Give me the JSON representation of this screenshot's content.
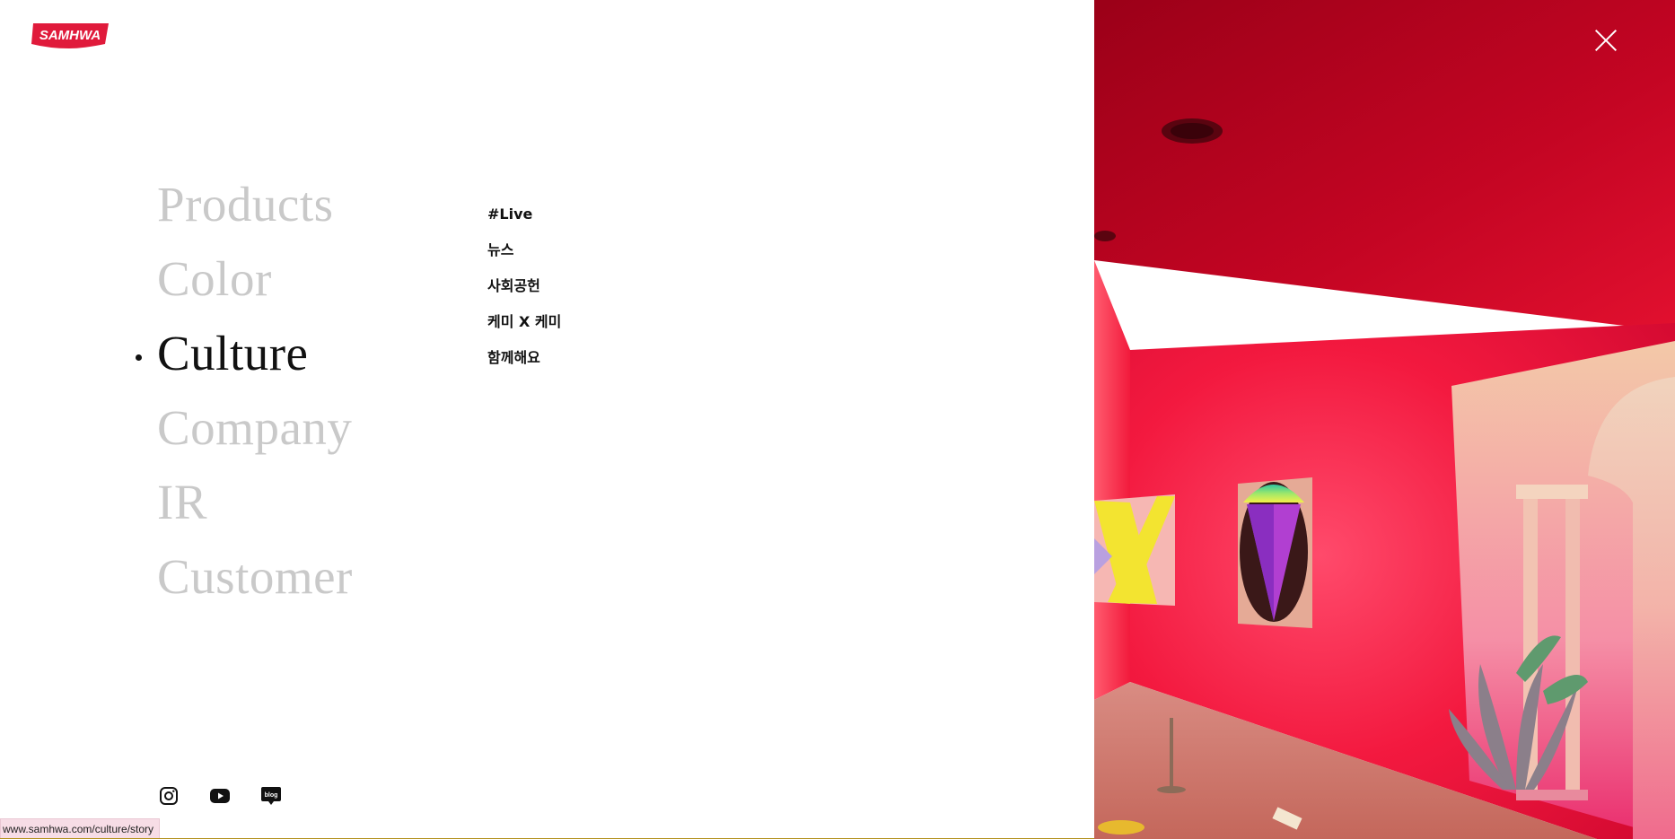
{
  "brand": {
    "logo_text": "SAMHWA",
    "color": "#e01a3b"
  },
  "main_menu": {
    "items": [
      {
        "label": "Products",
        "active": false
      },
      {
        "label": "Color",
        "active": false
      },
      {
        "label": "Culture",
        "active": true
      },
      {
        "label": "Company",
        "active": false
      },
      {
        "label": "IR",
        "active": false
      },
      {
        "label": "Customer",
        "active": false
      }
    ]
  },
  "sub_menu": {
    "items": [
      {
        "label": "#Live"
      },
      {
        "label": "뉴스"
      },
      {
        "label": "사회공헌"
      },
      {
        "label": "케미 X 케미"
      },
      {
        "label": "함께해요"
      }
    ]
  },
  "social": {
    "icons": [
      "instagram-icon",
      "youtube-icon",
      "blog-icon"
    ],
    "blog_label": "blog"
  },
  "status_bar": {
    "url": "www.samhwa.com/culture/story"
  },
  "hero": {
    "close_icon": "close-icon",
    "accent_color": "#e8163c"
  }
}
